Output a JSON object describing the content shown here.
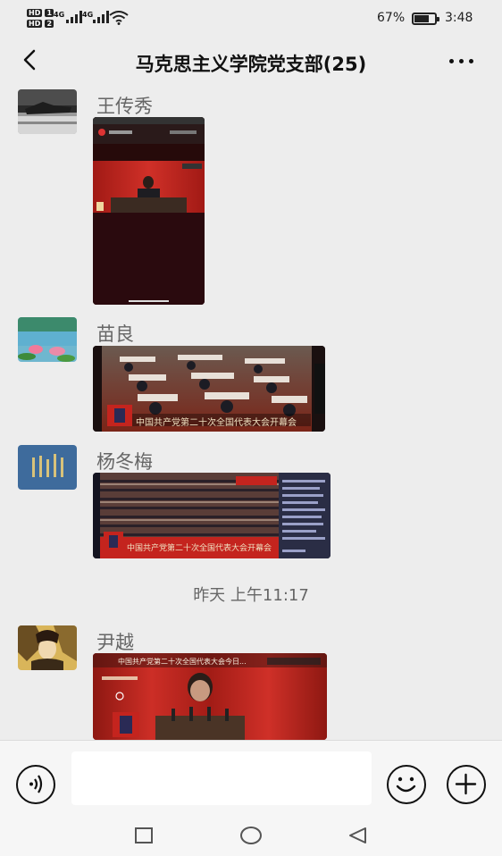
{
  "status_bar": {
    "hd_label_1": "HD",
    "hd_sim_1": "1",
    "hd_label_2": "HD",
    "hd_sim_2": "2",
    "network_1": "4G",
    "network_2": "4G",
    "battery_percent": "67%",
    "battery_level": 0.67,
    "time": "3:48"
  },
  "header": {
    "back_icon": "chevron-left-icon",
    "title": "马克思主义学院党支部(25)",
    "more_icon": "more-horizontal-icon"
  },
  "messages": [
    {
      "sender": "王传秀",
      "avatar": "landscape-photo",
      "media": "video-thumbnail"
    },
    {
      "sender": "苗良",
      "avatar": "lotus-pond-photo",
      "media": "video-thumbnail"
    },
    {
      "sender": "杨冬梅",
      "avatar": "blue-pattern-photo",
      "media": "video-thumbnail"
    },
    {
      "sender": "尹越",
      "avatar": "illustration-photo",
      "media": "video-thumbnail"
    }
  ],
  "time_separator": "昨天 上午11:17",
  "video_captions": {
    "caption_2": "中国共产党第二十次全国代表大会开幕会",
    "caption_3": "中国共产党第二十次全国代表大会开幕会",
    "caption_4_top": "中国共产党第二十次全国代表大会今日..."
  },
  "input_bar": {
    "voice_icon": "voice-icon",
    "input_value": "",
    "emoji_icon": "emoji-icon",
    "plus_icon": "plus-circle-icon"
  },
  "system_nav": {
    "recent_icon": "square-icon",
    "home_icon": "circle-icon",
    "back_icon": "triangle-back-icon"
  },
  "colors": {
    "background": "#ededed",
    "broadcast_red": "#c4241e",
    "dark_bg": "#1a0a0a"
  }
}
